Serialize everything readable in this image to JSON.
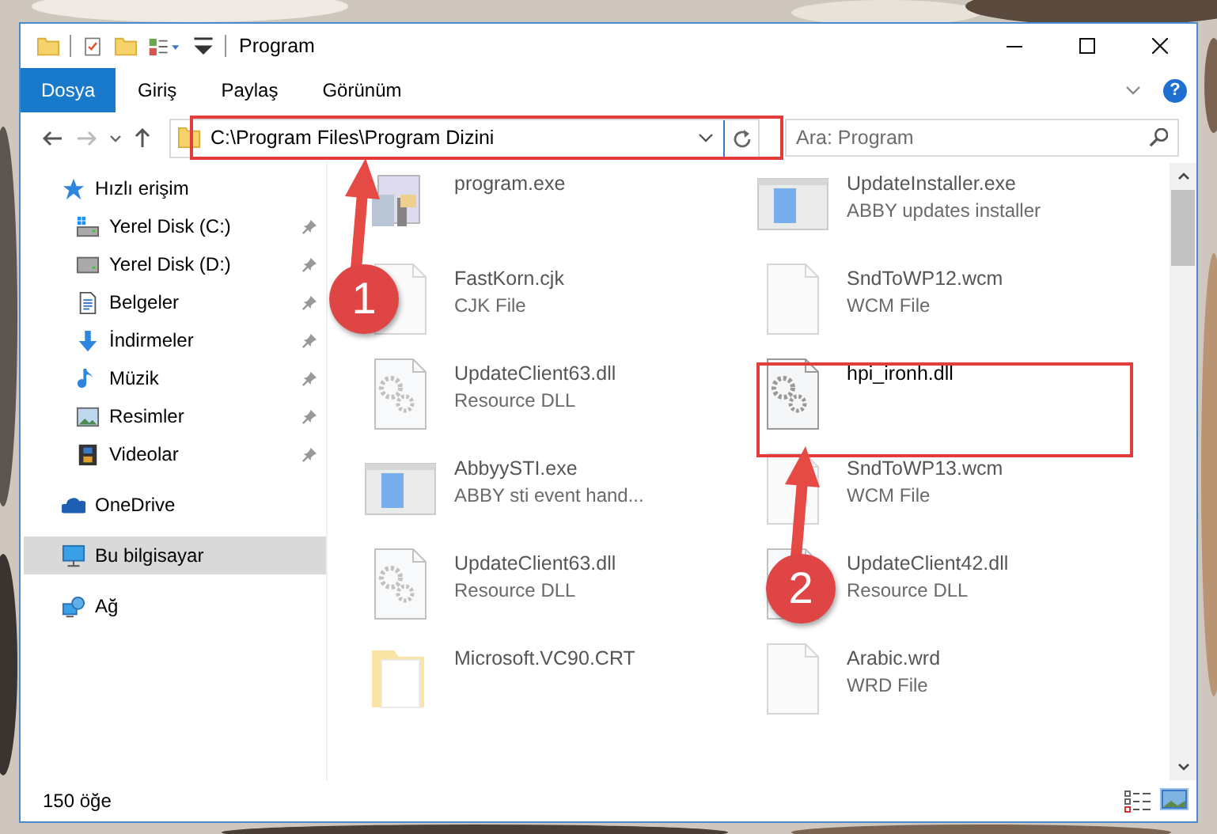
{
  "window": {
    "title": "Program"
  },
  "ribbon": {
    "tabs": [
      {
        "label": "Dosya",
        "selected": true
      },
      {
        "label": "Giriş",
        "selected": false
      },
      {
        "label": "Paylaş",
        "selected": false
      },
      {
        "label": "Görünüm",
        "selected": false
      }
    ],
    "help": "?"
  },
  "address_bar": {
    "path": "C:\\Program Files\\Program Dizini"
  },
  "search": {
    "placeholder": "Ara: Program"
  },
  "sidebar": {
    "items": [
      {
        "label": "Hızlı erişim",
        "kind": "star",
        "selected": false,
        "children": [
          {
            "label": "Yerel Disk (C:)",
            "kind": "drive-c",
            "pinned": true
          },
          {
            "label": "Yerel Disk (D:)",
            "kind": "drive",
            "pinned": true
          },
          {
            "label": "Belgeler",
            "kind": "docs",
            "pinned": true
          },
          {
            "label": "İndirmeler",
            "kind": "download",
            "pinned": true
          },
          {
            "label": "Müzik",
            "kind": "music",
            "pinned": true
          },
          {
            "label": "Resimler",
            "kind": "pictures",
            "pinned": true
          },
          {
            "label": "Videolar",
            "kind": "video",
            "pinned": true
          }
        ]
      },
      {
        "label": "OneDrive",
        "kind": "cloud",
        "selected": false
      },
      {
        "label": "Bu bilgisayar",
        "kind": "computer",
        "selected": true
      },
      {
        "label": "Ağ",
        "kind": "network",
        "selected": false
      }
    ]
  },
  "files": [
    {
      "name": "program.exe",
      "kind": "installer",
      "blurred": true
    },
    {
      "name": "UpdateInstaller.exe",
      "type": "ABBY updates installer",
      "kind": "app",
      "blurred": true
    },
    {
      "name": "FastKorn.cjk",
      "type": "CJK File",
      "kind": "doc",
      "blurred": true
    },
    {
      "name": "SndToWP12.wcm",
      "type": "WCM File",
      "kind": "doc",
      "blurred": true
    },
    {
      "name": "UpdateClient63.dll",
      "type": "Resource DLL",
      "kind": "dll",
      "blurred": true
    },
    {
      "name": "hpi_ironh.dll",
      "kind": "dll",
      "blurred": false
    },
    {
      "name": "AbbyySTI.exe",
      "type": "ABBY sti event hand...",
      "kind": "app",
      "blurred": true
    },
    {
      "name": "SndToWP13.wcm",
      "type": "WCM File",
      "kind": "doc",
      "blurred": true
    },
    {
      "name": "UpdateClient63.dll",
      "type": "Resource DLL",
      "kind": "dll",
      "blurred": true
    },
    {
      "name": "UpdateClient42.dll",
      "type": "Resource DLL",
      "kind": "dll",
      "blurred": true
    },
    {
      "name": "Microsoft.VC90.CRT",
      "kind": "folder",
      "blurred": true
    },
    {
      "name": "Arabic.wrd",
      "type": "WRD File",
      "kind": "doc",
      "blurred": true
    }
  ],
  "status_bar": {
    "count": "150 öğe"
  },
  "annotations": [
    {
      "number": "1"
    },
    {
      "number": "2"
    }
  ]
}
